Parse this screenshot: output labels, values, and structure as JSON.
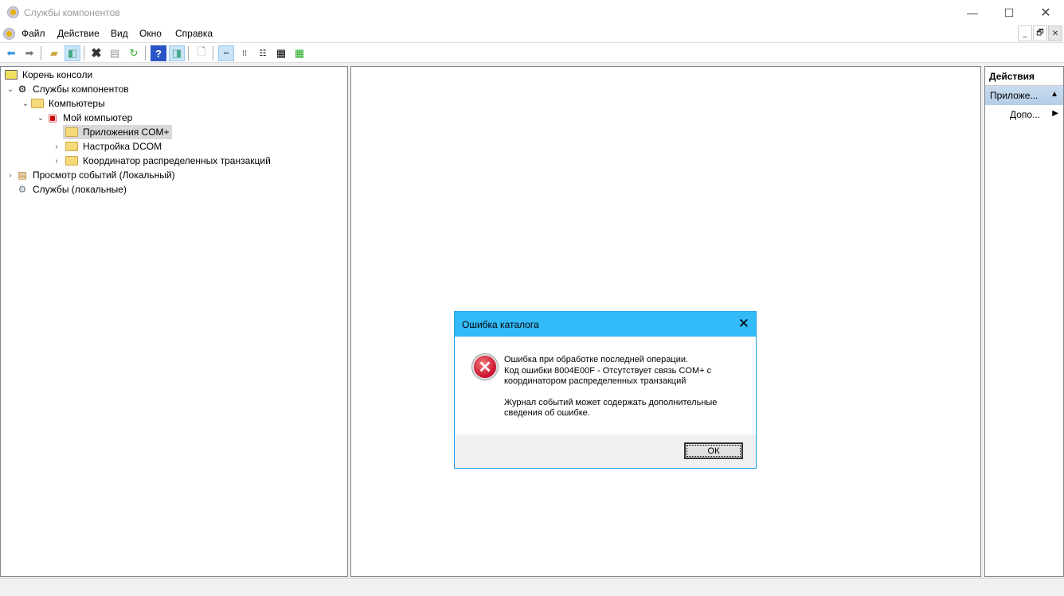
{
  "window": {
    "title": "Службы компонентов"
  },
  "menu": [
    "Файл",
    "Действие",
    "Вид",
    "Окно",
    "Справка"
  ],
  "tree": [
    {
      "label": "Корень консоли"
    },
    {
      "label": "Службы компонентов"
    },
    {
      "label": "Компьютеры"
    },
    {
      "label": "Мой компьютер"
    },
    {
      "label": "Приложения COM+"
    },
    {
      "label": "Настройка DCOM"
    },
    {
      "label": "Координатор распределенных транзакций"
    },
    {
      "label": "Просмотр событий (Локальный)"
    },
    {
      "label": "Службы (локальные)"
    }
  ],
  "actions": {
    "header": "Действия",
    "section": "Приложе...",
    "item": "Допо..."
  },
  "dialog": {
    "title": "Ошибка каталога",
    "line1": "Ошибка при обработке последней операции.",
    "line2": "Код ошибки 8004E00F - Отсутствует связь COM+ с",
    "line3": "координатором распределенных транзакций",
    "line4": "Журнал событий может содержать дополнительные",
    "line5": "сведения об ошибке.",
    "ok": "ОК"
  }
}
